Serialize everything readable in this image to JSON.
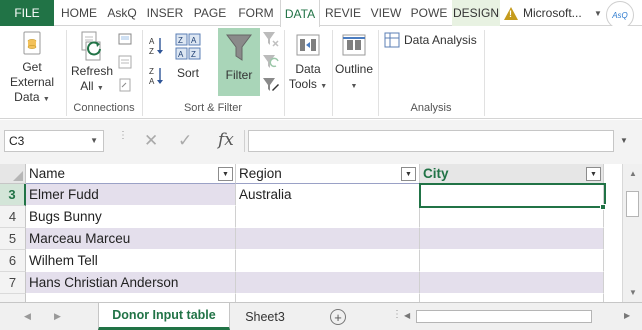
{
  "tabs": {
    "file": "FILE",
    "items": [
      {
        "label": "HOME"
      },
      {
        "label": "AskQ"
      },
      {
        "label": "INSER"
      },
      {
        "label": "PAGE"
      },
      {
        "label": "FORM"
      },
      {
        "label": "DATA"
      },
      {
        "label": "REVIE"
      },
      {
        "label": "VIEW"
      },
      {
        "label": "POWE"
      },
      {
        "label": "DESIGN"
      }
    ],
    "active": "DATA",
    "account_label": "Microsoft...",
    "warning_glyph": "!"
  },
  "ribbon": {
    "get_external_data": {
      "line1": "Get External",
      "line2": "Data"
    },
    "refresh_all": {
      "line1": "Refresh",
      "line2": "All"
    },
    "sort_az_glyph": "A↓Z",
    "sort_za_glyph": "Z↓A",
    "sort": "Sort",
    "filter": "Filter",
    "data_tools": {
      "line1": "Data",
      "line2": "Tools"
    },
    "outline": "Outline",
    "data_analysis": "Data Analysis",
    "groups": {
      "connections": "Connections",
      "sort_filter": "Sort & Filter",
      "analysis": "Analysis"
    }
  },
  "formula_bar": {
    "name_box": "C3",
    "cancel_glyph": "✕",
    "enter_glyph": "✓",
    "fx": "fx",
    "value": ""
  },
  "table": {
    "headers": [
      "Name",
      "Region",
      "City"
    ],
    "rows": [
      {
        "row": "3",
        "cells": [
          "Elmer Fudd",
          "Australia",
          ""
        ]
      },
      {
        "row": "4",
        "cells": [
          "Bugs Bunny",
          "",
          ""
        ]
      },
      {
        "row": "5",
        "cells": [
          "Marceau Marceu",
          "",
          ""
        ]
      },
      {
        "row": "6",
        "cells": [
          "Wilhem Tell",
          "",
          ""
        ]
      },
      {
        "row": "7",
        "cells": [
          "Hans Christian Anderson",
          "",
          ""
        ]
      }
    ],
    "active_cell": "C3"
  },
  "sheets": {
    "tabs": [
      "Donor Input table",
      "Sheet3"
    ],
    "active": "Donor Input table",
    "add_glyph": "+"
  },
  "colors": {
    "excel_green": "#217346",
    "band_purple": "#e4dfec",
    "filter_highlight": "#a9d5b8"
  },
  "icons": {
    "file-tab": "none",
    "get-external-data": "database-icon",
    "refresh-all": "refresh-icon",
    "sort-az": "sort-ascending-icon",
    "sort-za": "sort-descending-icon",
    "sort": "sort-icon",
    "filter": "funnel-icon",
    "clear": "clear-filter-icon",
    "reapply": "reapply-icon",
    "advanced": "advanced-filter-icon",
    "data-tools": "data-tools-icon",
    "outline": "outline-icon",
    "data-analysis": "data-analysis-icon"
  }
}
